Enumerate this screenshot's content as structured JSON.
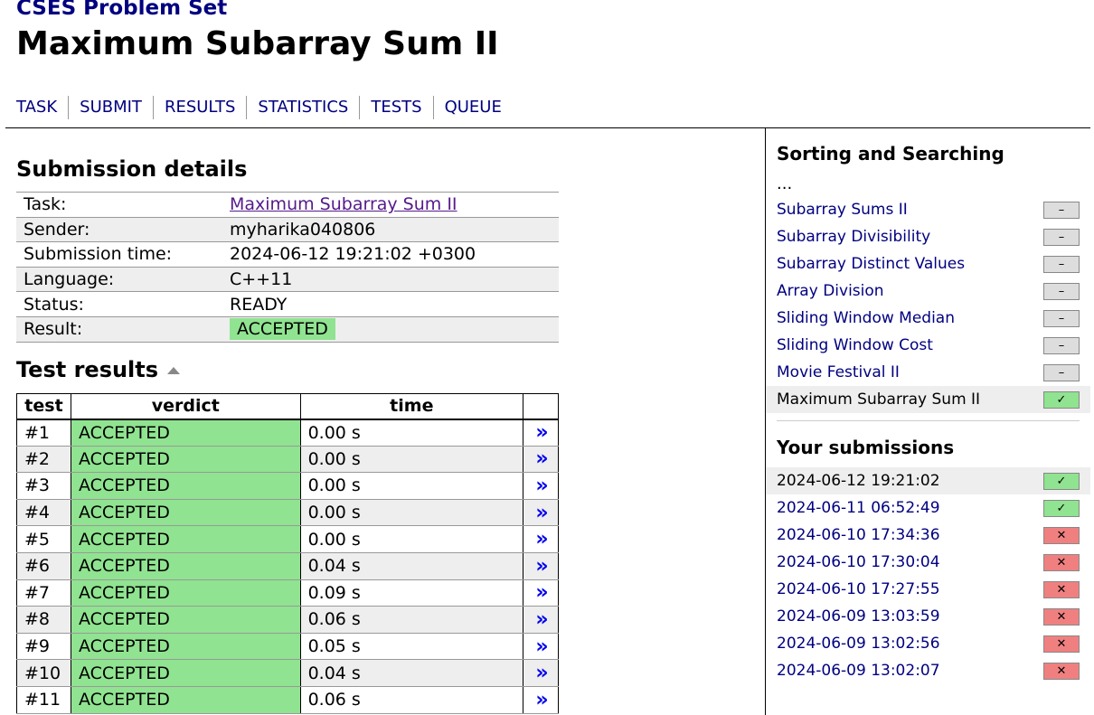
{
  "header": {
    "site_title": "CSES Problem Set",
    "page_title": "Maximum Subarray Sum II",
    "nav": [
      "TASK",
      "SUBMIT",
      "RESULTS",
      "STATISTICS",
      "TESTS",
      "QUEUE"
    ]
  },
  "details": {
    "heading": "Submission details",
    "rows": [
      {
        "label": "Task:",
        "value": "Maximum Subarray Sum II"
      },
      {
        "label": "Sender:",
        "value": "myharika040806"
      },
      {
        "label": "Submission time:",
        "value": "2024-06-12 19:21:02 +0300"
      },
      {
        "label": "Language:",
        "value": "C++11"
      },
      {
        "label": "Status:",
        "value": "READY"
      },
      {
        "label": "Result:",
        "value": "ACCEPTED"
      }
    ]
  },
  "tests": {
    "heading": "Test results",
    "columns": [
      "test",
      "verdict",
      "time",
      ""
    ],
    "link_glyph": "»",
    "rows": [
      {
        "test": "#1",
        "verdict": "ACCEPTED",
        "time": "0.00 s"
      },
      {
        "test": "#2",
        "verdict": "ACCEPTED",
        "time": "0.00 s"
      },
      {
        "test": "#3",
        "verdict": "ACCEPTED",
        "time": "0.00 s"
      },
      {
        "test": "#4",
        "verdict": "ACCEPTED",
        "time": "0.00 s"
      },
      {
        "test": "#5",
        "verdict": "ACCEPTED",
        "time": "0.00 s"
      },
      {
        "test": "#6",
        "verdict": "ACCEPTED",
        "time": "0.04 s"
      },
      {
        "test": "#7",
        "verdict": "ACCEPTED",
        "time": "0.09 s"
      },
      {
        "test": "#8",
        "verdict": "ACCEPTED",
        "time": "0.06 s"
      },
      {
        "test": "#9",
        "verdict": "ACCEPTED",
        "time": "0.05 s"
      },
      {
        "test": "#10",
        "verdict": "ACCEPTED",
        "time": "0.04 s"
      },
      {
        "test": "#11",
        "verdict": "ACCEPTED",
        "time": "0.06 s"
      }
    ]
  },
  "sidebar": {
    "section_title": "Sorting and Searching",
    "ellipsis": "...",
    "tasks": [
      {
        "name": "Subarray Sums II",
        "status": "none"
      },
      {
        "name": "Subarray Divisibility",
        "status": "none"
      },
      {
        "name": "Subarray Distinct Values",
        "status": "none"
      },
      {
        "name": "Array Division",
        "status": "none"
      },
      {
        "name": "Sliding Window Median",
        "status": "none"
      },
      {
        "name": "Sliding Window Cost",
        "status": "none"
      },
      {
        "name": "Movie Festival II",
        "status": "none"
      },
      {
        "name": "Maximum Subarray Sum II",
        "status": "full",
        "current": true
      }
    ],
    "submissions_title": "Your submissions",
    "submissions": [
      {
        "time": "2024-06-12 19:21:02",
        "status": "full",
        "current": true
      },
      {
        "time": "2024-06-11 06:52:49",
        "status": "full"
      },
      {
        "time": "2024-06-10 17:34:36",
        "status": "zero"
      },
      {
        "time": "2024-06-10 17:30:04",
        "status": "zero"
      },
      {
        "time": "2024-06-10 17:27:55",
        "status": "zero"
      },
      {
        "time": "2024-06-09 13:03:59",
        "status": "zero"
      },
      {
        "time": "2024-06-09 13:02:56",
        "status": "zero"
      },
      {
        "time": "2024-06-09 13:02:07",
        "status": "zero"
      }
    ],
    "status_glyphs": {
      "none": "–",
      "full": "✓",
      "zero": "✕"
    }
  },
  "colors": {
    "accent": "#000080",
    "accepted": "#90e390",
    "wrong": "#f08080",
    "row_alt": "#eeeeee"
  }
}
